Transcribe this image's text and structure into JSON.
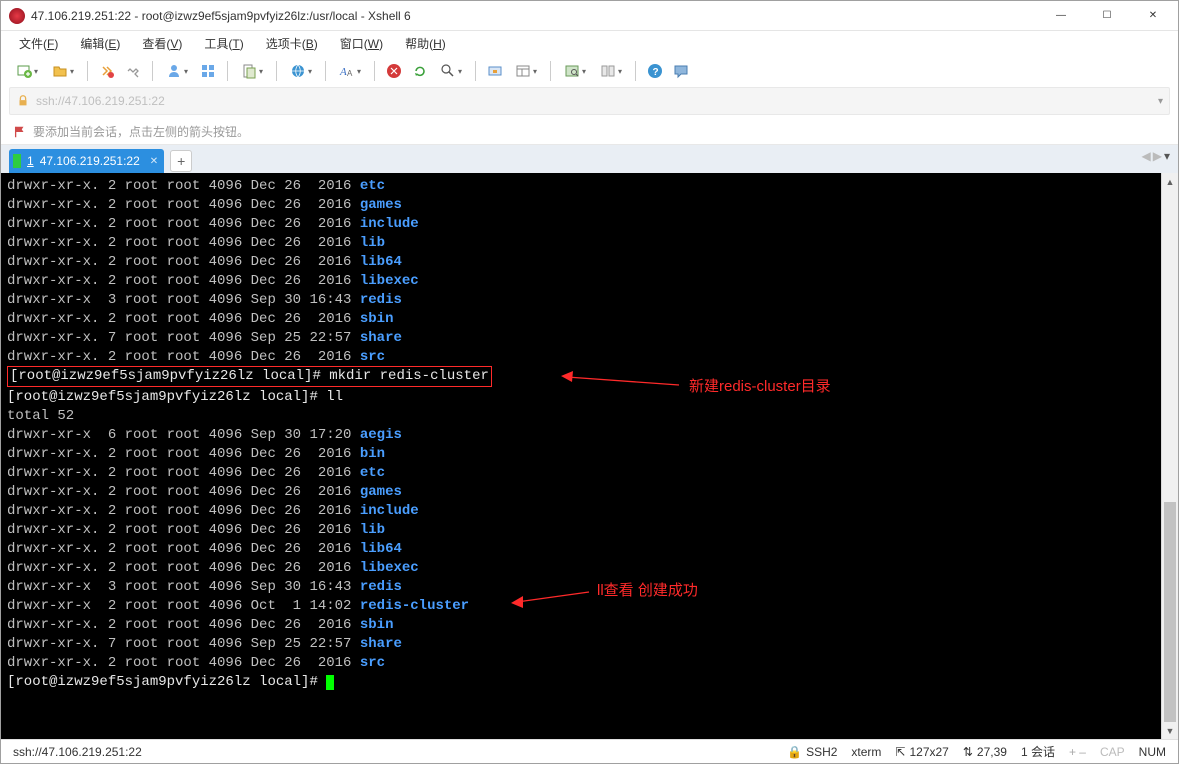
{
  "window": {
    "title": "47.106.219.251:22 - root@izwz9ef5sjam9pvfyiz26lz:/usr/local - Xshell 6",
    "minimize": "—",
    "maximize": "☐",
    "close": "✕"
  },
  "menubar": {
    "items": [
      {
        "label": "文件",
        "key": "F"
      },
      {
        "label": "编辑",
        "key": "E"
      },
      {
        "label": "查看",
        "key": "V"
      },
      {
        "label": "工具",
        "key": "T"
      },
      {
        "label": "选项卡",
        "key": "B"
      },
      {
        "label": "窗口",
        "key": "W"
      },
      {
        "label": "帮助",
        "key": "H"
      }
    ]
  },
  "address": {
    "text": "ssh://47.106.219.251:22"
  },
  "hint": {
    "text": "要添加当前会话，点击左侧的箭头按钮。"
  },
  "tab": {
    "index": "1",
    "label": "47.106.219.251:22",
    "add": "+"
  },
  "terminal": {
    "listing1": [
      {
        "perm": "drwxr-xr-x.",
        "links": "2",
        "owner": "root",
        "group": "root",
        "size": "4096",
        "date": "Dec 26  2016",
        "name": "etc"
      },
      {
        "perm": "drwxr-xr-x.",
        "links": "2",
        "owner": "root",
        "group": "root",
        "size": "4096",
        "date": "Dec 26  2016",
        "name": "games"
      },
      {
        "perm": "drwxr-xr-x.",
        "links": "2",
        "owner": "root",
        "group": "root",
        "size": "4096",
        "date": "Dec 26  2016",
        "name": "include"
      },
      {
        "perm": "drwxr-xr-x.",
        "links": "2",
        "owner": "root",
        "group": "root",
        "size": "4096",
        "date": "Dec 26  2016",
        "name": "lib"
      },
      {
        "perm": "drwxr-xr-x.",
        "links": "2",
        "owner": "root",
        "group": "root",
        "size": "4096",
        "date": "Dec 26  2016",
        "name": "lib64"
      },
      {
        "perm": "drwxr-xr-x.",
        "links": "2",
        "owner": "root",
        "group": "root",
        "size": "4096",
        "date": "Dec 26  2016",
        "name": "libexec"
      },
      {
        "perm": "drwxr-xr-x ",
        "links": "3",
        "owner": "root",
        "group": "root",
        "size": "4096",
        "date": "Sep 30 16:43",
        "name": "redis"
      },
      {
        "perm": "drwxr-xr-x.",
        "links": "2",
        "owner": "root",
        "group": "root",
        "size": "4096",
        "date": "Dec 26  2016",
        "name": "sbin"
      },
      {
        "perm": "drwxr-xr-x.",
        "links": "7",
        "owner": "root",
        "group": "root",
        "size": "4096",
        "date": "Sep 25 22:57",
        "name": "share"
      },
      {
        "perm": "drwxr-xr-x.",
        "links": "2",
        "owner": "root",
        "group": "root",
        "size": "4096",
        "date": "Dec 26  2016",
        "name": "src"
      }
    ],
    "prompt1": "[root@izwz9ef5sjam9pvfyiz26lz local]# mkdir redis-cluster",
    "prompt2": "[root@izwz9ef5sjam9pvfyiz26lz local]# ll",
    "total": "total 52",
    "listing2": [
      {
        "perm": "drwxr-xr-x ",
        "links": "6",
        "owner": "root",
        "group": "root",
        "size": "4096",
        "date": "Sep 30 17:20",
        "name": "aegis"
      },
      {
        "perm": "drwxr-xr-x.",
        "links": "2",
        "owner": "root",
        "group": "root",
        "size": "4096",
        "date": "Dec 26  2016",
        "name": "bin"
      },
      {
        "perm": "drwxr-xr-x.",
        "links": "2",
        "owner": "root",
        "group": "root",
        "size": "4096",
        "date": "Dec 26  2016",
        "name": "etc"
      },
      {
        "perm": "drwxr-xr-x.",
        "links": "2",
        "owner": "root",
        "group": "root",
        "size": "4096",
        "date": "Dec 26  2016",
        "name": "games"
      },
      {
        "perm": "drwxr-xr-x.",
        "links": "2",
        "owner": "root",
        "group": "root",
        "size": "4096",
        "date": "Dec 26  2016",
        "name": "include"
      },
      {
        "perm": "drwxr-xr-x.",
        "links": "2",
        "owner": "root",
        "group": "root",
        "size": "4096",
        "date": "Dec 26  2016",
        "name": "lib"
      },
      {
        "perm": "drwxr-xr-x.",
        "links": "2",
        "owner": "root",
        "group": "root",
        "size": "4096",
        "date": "Dec 26  2016",
        "name": "lib64"
      },
      {
        "perm": "drwxr-xr-x.",
        "links": "2",
        "owner": "root",
        "group": "root",
        "size": "4096",
        "date": "Dec 26  2016",
        "name": "libexec"
      },
      {
        "perm": "drwxr-xr-x ",
        "links": "3",
        "owner": "root",
        "group": "root",
        "size": "4096",
        "date": "Sep 30 16:43",
        "name": "redis"
      },
      {
        "perm": "drwxr-xr-x ",
        "links": "2",
        "owner": "root",
        "group": "root",
        "size": "4096",
        "date": "Oct  1 14:02",
        "name": "redis-cluster"
      },
      {
        "perm": "drwxr-xr-x.",
        "links": "2",
        "owner": "root",
        "group": "root",
        "size": "4096",
        "date": "Dec 26  2016",
        "name": "sbin"
      },
      {
        "perm": "drwxr-xr-x.",
        "links": "7",
        "owner": "root",
        "group": "root",
        "size": "4096",
        "date": "Sep 25 22:57",
        "name": "share"
      },
      {
        "perm": "drwxr-xr-x.",
        "links": "2",
        "owner": "root",
        "group": "root",
        "size": "4096",
        "date": "Dec 26  2016",
        "name": "src"
      }
    ],
    "prompt3": "[root@izwz9ef5sjam9pvfyiz26lz local]# "
  },
  "annotations": {
    "a1": "新建redis-cluster目录",
    "a2": "ll查看  创建成功"
  },
  "statusbar": {
    "path": "ssh://47.106.219.251:22",
    "ssh": "SSH2",
    "term": "xterm",
    "size": "127x27",
    "size_icon": "⇱",
    "pos": "27,39",
    "sessions_label": "1 会话",
    "cap": "CAP",
    "num": "NUM",
    "arrows": "⇅",
    "sep": "+ ‒"
  }
}
